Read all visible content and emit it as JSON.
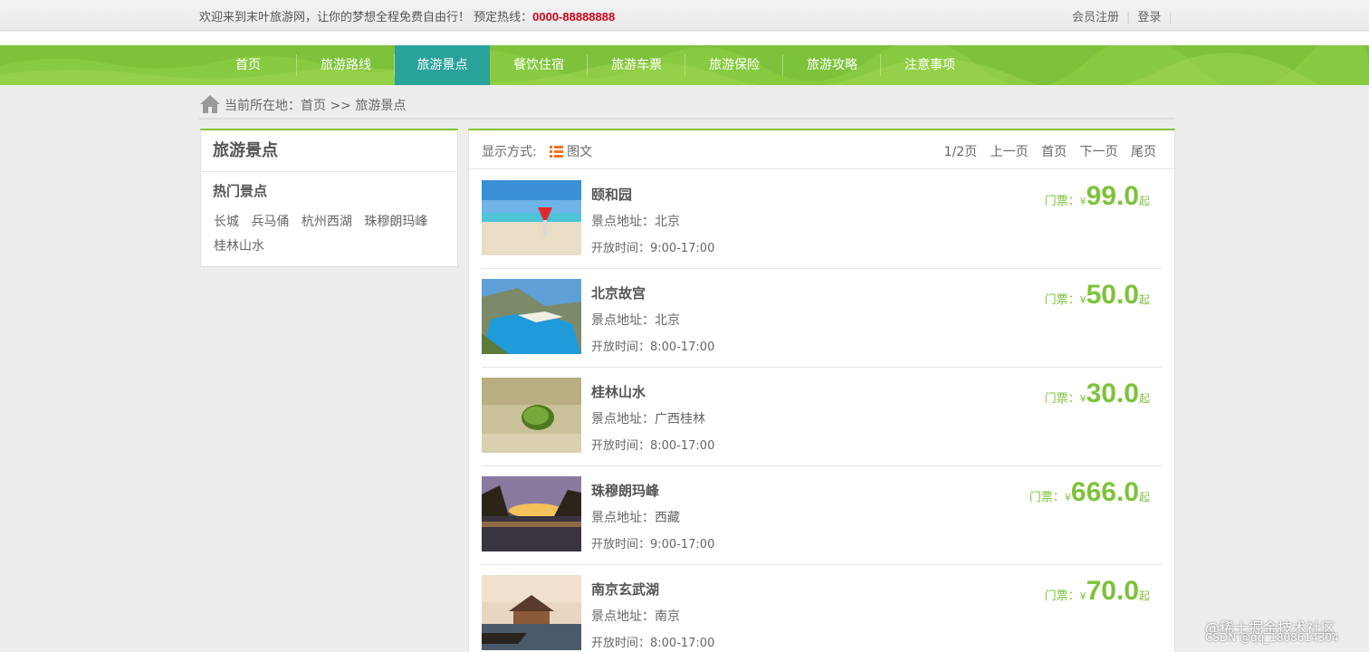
{
  "topbar": {
    "welcome": "欢迎来到末叶旅游网，让你的梦想全程免费自由行！ 预定热线：",
    "hotline": "0000-88888888",
    "register": "会员注册",
    "login": "登录"
  },
  "nav": {
    "items": [
      "首页",
      "旅游路线",
      "旅游景点",
      "餐饮住宿",
      "旅游车票",
      "旅游保险",
      "旅游攻略",
      "注意事项"
    ],
    "active_index": 2
  },
  "breadcrumb": {
    "prefix": "当前所在地：",
    "home": "首页",
    "separator": ">>",
    "current": "旅游景点"
  },
  "sidebar": {
    "title": "旅游景点",
    "hot_title": "热门景点",
    "tags": [
      "长城",
      "兵马俑",
      "杭州西湖",
      "珠穆朗玛峰",
      "桂林山水"
    ]
  },
  "main": {
    "display_label": "显示方式:",
    "display_mode": "图文",
    "page_info": "1/2页",
    "prev": "上一页",
    "first": "首页",
    "next": "下一页",
    "last": "尾页"
  },
  "spots": [
    {
      "name": "颐和园",
      "address": "景点地址：北京",
      "hours": "开放时间：9:00-17:00",
      "price_label": "门票：",
      "currency": "¥",
      "price": "99.0",
      "suffix": "起",
      "image": "beach-drink"
    },
    {
      "name": "北京故宫",
      "address": "景点地址：北京",
      "hours": "开放时间：8:00-17:00",
      "price_label": "门票：",
      "currency": "¥",
      "price": "50.0",
      "suffix": "起",
      "image": "cliff-bay"
    },
    {
      "name": "桂林山水",
      "address": "景点地址：广西桂林",
      "hours": "开放时间：8:00-17:00",
      "price_label": "门票：",
      "currency": "¥",
      "price": "30.0",
      "suffix": "起",
      "image": "leaf-sand"
    },
    {
      "name": "珠穆朗玛峰",
      "address": "景点地址：西藏",
      "hours": "开放时间：9:00-17:00",
      "price_label": "门票：",
      "currency": "¥",
      "price": "666.0",
      "suffix": "起",
      "image": "sunset-lake"
    },
    {
      "name": "南京玄武湖",
      "address": "景点地址：南京",
      "hours": "开放时间：8:00-17:00",
      "price_label": "门票：",
      "currency": "¥",
      "price": "70.0",
      "suffix": "起",
      "image": "pavilion-boat"
    }
  ],
  "watermark": {
    "line1": "@稀土掘金技术社区",
    "line2": "CSDN @qq_1808614304"
  },
  "colors": {
    "green": "#7dc23a",
    "teal_active": "#2aa39b",
    "hotline_red": "#d0021b",
    "list_icon": "#f0731e"
  }
}
